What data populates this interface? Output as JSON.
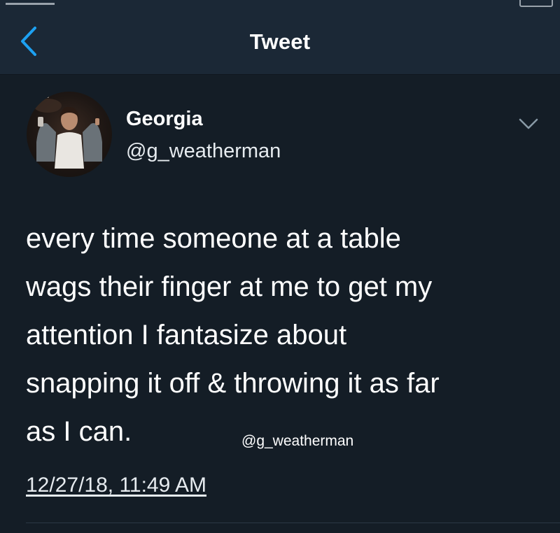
{
  "nav": {
    "title": "Tweet",
    "back_icon": "chevron-left-icon"
  },
  "tweet": {
    "display_name": "Georgia",
    "handle": "@g_weatherman",
    "text": "every time someone at a table\nwags their finger at me to get my\nattention I fantasize about\nsnapping it off & throwing it as far\nas I can.",
    "watermark": "@g_weatherman",
    "timestamp": "12/27/18, 11:49 AM",
    "more_icon": "chevron-down-icon"
  },
  "colors": {
    "background": "#141d26",
    "nav_background": "#1b2836",
    "accent": "#1da1f2",
    "text": "#ffffff"
  }
}
